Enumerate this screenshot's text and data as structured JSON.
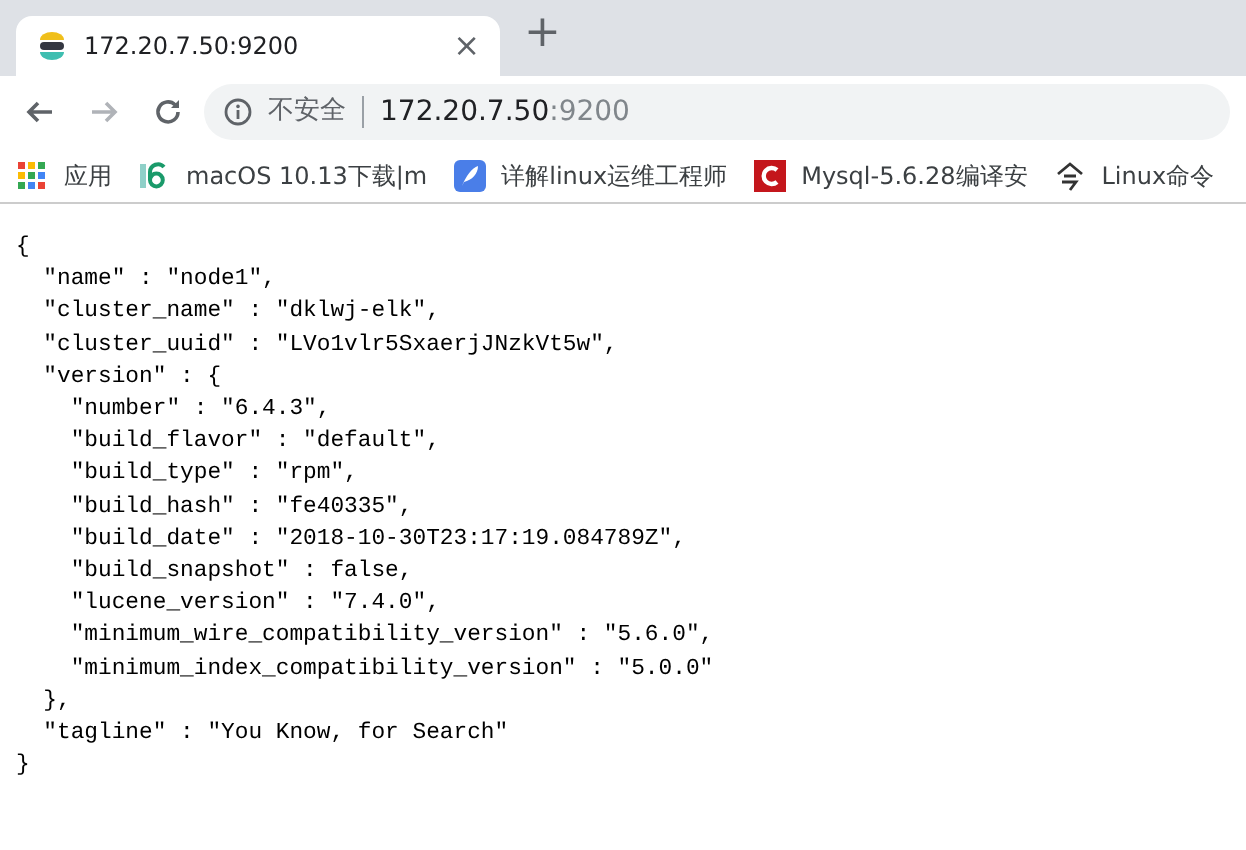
{
  "tab": {
    "title": "172.20.7.50:9200",
    "close": "×"
  },
  "new_tab": "+",
  "nav_buttons": [
    {
      "kind": "back",
      "disabled": false
    },
    {
      "kind": "forward",
      "disabled": true
    },
    {
      "kind": "reload",
      "disabled": false
    }
  ],
  "address": {
    "security": "不安全",
    "host": "172.20.7.50",
    "port": ":9200"
  },
  "bookmarks": [
    {
      "kind": "apps",
      "label": "应用"
    },
    {
      "kind": "six",
      "label": "macOS 10.13下载|m"
    },
    {
      "kind": "feather",
      "label": "详解linux运维工程师"
    },
    {
      "kind": "letter-c",
      "label": "Mysql-5.6.28编译安"
    },
    {
      "kind": "glyph",
      "label": "Linux命令"
    }
  ],
  "body_lines": [
    "{",
    "  \"name\" : \"node1\",",
    "  \"cluster_name\" : \"dklwj-elk\",",
    "  \"cluster_uuid\" : \"LVo1vlr5SxaerjJNzkVt5w\",",
    "  \"version\" : {",
    "    \"number\" : \"6.4.3\",",
    "    \"build_flavor\" : \"default\",",
    "    \"build_type\" : \"rpm\",",
    "    \"build_hash\" : \"fe40335\",",
    "    \"build_date\" : \"2018-10-30T23:17:19.084789Z\",",
    "    \"build_snapshot\" : false,",
    "    \"lucene_version\" : \"7.4.0\",",
    "    \"minimum_wire_compatibility_version\" : \"5.6.0\",",
    "    \"minimum_index_compatibility_version\" : \"5.0.0\"",
    "  },",
    "  \"tagline\" : \"You Know, for Search\"",
    "}"
  ]
}
